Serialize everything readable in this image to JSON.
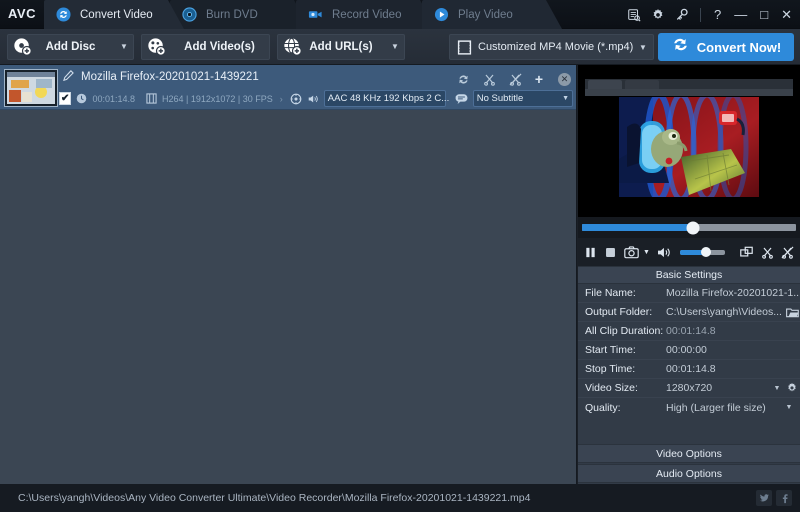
{
  "app": {
    "logo": "AVC",
    "accent_color": "#2e8ada",
    "selected_row_color": "#3d5a7b",
    "panel_color": "#323b47",
    "list_bg_color": "#3b4653"
  },
  "titlebar": {
    "tabs": [
      {
        "label": "Convert Video",
        "icon": "convert-icon",
        "active": true
      },
      {
        "label": "Burn DVD",
        "icon": "disc-icon",
        "active": false
      },
      {
        "label": "Record Video",
        "icon": "camera-icon",
        "active": false
      },
      {
        "label": "Play Video",
        "icon": "play-icon",
        "active": false
      }
    ],
    "tools": [
      {
        "name": "log-icon",
        "title": "Conversion Log"
      },
      {
        "name": "gear-icon",
        "title": "Preferences"
      },
      {
        "name": "key-icon",
        "title": "License"
      }
    ],
    "help_label": "?",
    "minimize_label": "—",
    "maximize_label": "□",
    "close_label": "✕"
  },
  "toolbar": {
    "add_disc_label": "Add Disc",
    "add_video_label": "Add Video(s)",
    "add_url_label": "Add URL(s)",
    "profile_value": "Customized MP4 Movie (*.mp4)",
    "convert_label": "Convert Now!"
  },
  "file_item": {
    "title": "Mozilla Firefox-20201021-1439221",
    "checked": true,
    "check_glyph": "✔",
    "duration": "00:01:14.8",
    "video_info": "H264 | 1912x1072 | 30 FPS",
    "audio_track": "AAC 48 KHz 192 Kbps 2 C...",
    "subtitle_track": "No Subtitle",
    "tools": [
      {
        "name": "rotate-icon"
      },
      {
        "name": "cut-icon"
      },
      {
        "name": "merge-icon"
      }
    ],
    "add_glyph": "+",
    "close_glyph": "✕"
  },
  "player": {
    "seek_percent": 52,
    "volume_percent": 58,
    "controls": [
      {
        "name": "pause-button"
      },
      {
        "name": "stop-button"
      },
      {
        "name": "snapshot-button"
      },
      {
        "name": "snapshot-dropdown"
      },
      {
        "name": "volume-button"
      },
      {
        "name": "fullscreen-button"
      },
      {
        "name": "clip-button"
      },
      {
        "name": "effect-button"
      }
    ]
  },
  "basic_settings": {
    "header": "Basic Settings",
    "rows": [
      {
        "label": "File Name:",
        "value": "Mozilla Firefox-20201021-1...",
        "dim": false,
        "folder": false,
        "caret": false,
        "gear": false
      },
      {
        "label": "Output Folder:",
        "value": "C:\\Users\\yangh\\Videos...",
        "dim": false,
        "folder": true,
        "caret": false,
        "gear": false
      },
      {
        "label": "All Clip Duration:",
        "value": "00:01:14.8",
        "dim": true,
        "folder": false,
        "caret": false,
        "gear": false
      },
      {
        "label": "Start Time:",
        "value": "00:00:00",
        "dim": false,
        "folder": false,
        "caret": false,
        "gear": false
      },
      {
        "label": "Stop Time:",
        "value": "00:01:14.8",
        "dim": false,
        "folder": false,
        "caret": false,
        "gear": false
      },
      {
        "label": "Video Size:",
        "value": "1280x720",
        "dim": false,
        "folder": false,
        "caret": true,
        "gear": true
      },
      {
        "label": "Quality:",
        "value": "High (Larger file size)",
        "dim": false,
        "folder": false,
        "caret": true,
        "gear": false
      }
    ]
  },
  "options": {
    "video_options_label": "Video Options",
    "audio_options_label": "Audio Options"
  },
  "statusbar": {
    "path": "C:\\Users\\yangh\\Videos\\Any Video Converter Ultimate\\Video Recorder\\Mozilla Firefox-20201021-1439221.mp4",
    "social": [
      {
        "name": "twitter-icon"
      },
      {
        "name": "facebook-icon"
      }
    ]
  }
}
